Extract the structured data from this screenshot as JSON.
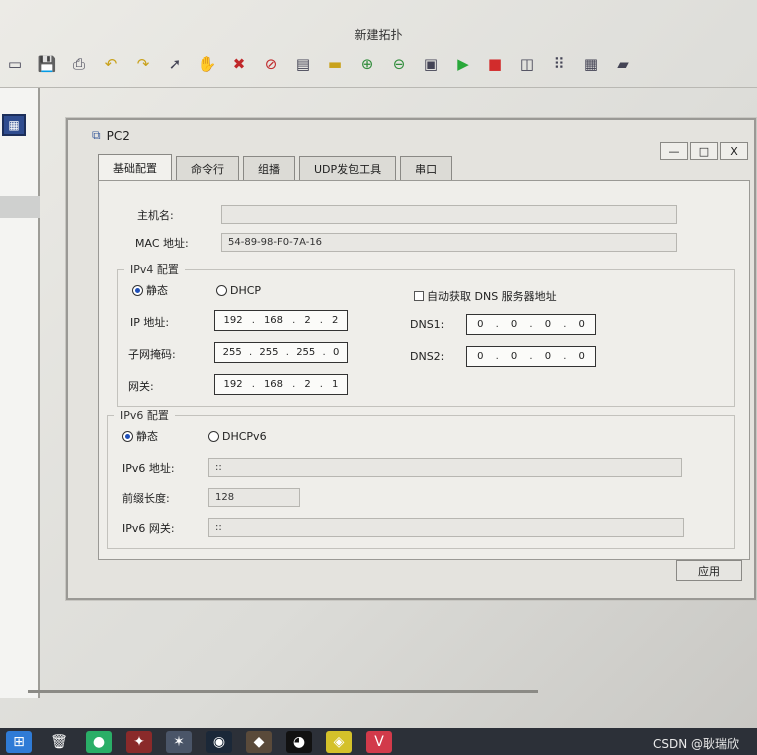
{
  "app": {
    "title": "新建拓扑"
  },
  "toolbar": {
    "icons": [
      "open-icon",
      "save-icon",
      "print-icon",
      "undo-icon",
      "redo-icon",
      "pointer-icon",
      "hand-icon",
      "delete-icon",
      "delete-link-icon",
      "text-icon",
      "rectangle-icon",
      "zoom-in-icon",
      "zoom-out-icon",
      "fit-icon",
      "start-icon",
      "stop-icon",
      "capture-icon",
      "topology-icon",
      "grid-icon",
      "cli-icon"
    ]
  },
  "dialog": {
    "title": "PC2",
    "controls": {
      "minimize": "—",
      "maximize": "□",
      "close": "X"
    },
    "tabs": [
      {
        "label": "基础配置",
        "active": true
      },
      {
        "label": "命令行",
        "active": false
      },
      {
        "label": "组播",
        "active": false
      },
      {
        "label": "UDP发包工具",
        "active": false
      },
      {
        "label": "串口",
        "active": false
      }
    ],
    "basic": {
      "hostname_label": "主机名:",
      "hostname_value": "",
      "mac_label": "MAC 地址:",
      "mac_value": "54-89-98-F0-7A-16"
    },
    "ipv4": {
      "title": "IPv4 配置",
      "static_label": "静态",
      "dhcp_label": "DHCP",
      "mode": "static",
      "auto_dns_label": "自动获取 DNS 服务器地址",
      "auto_dns_checked": false,
      "ip_label": "IP 地址:",
      "ip": [
        "192",
        "168",
        "2",
        "2"
      ],
      "mask_label": "子网掩码:",
      "mask": [
        "255",
        "255",
        "255",
        "0"
      ],
      "gateway_label": "网关:",
      "gateway": [
        "192",
        "168",
        "2",
        "1"
      ],
      "dns1_label": "DNS1:",
      "dns1": [
        "0",
        "0",
        "0",
        "0"
      ],
      "dns2_label": "DNS2:",
      "dns2": [
        "0",
        "0",
        "0",
        "0"
      ],
      "dot": "."
    },
    "ipv6": {
      "title": "IPv6 配置",
      "static_label": "静态",
      "dhcp_label": "DHCPv6",
      "mode": "static",
      "addr_label": "IPv6 地址:",
      "addr_value": "::",
      "prefix_label": "前缀长度:",
      "prefix_value": "128",
      "gw_label": "IPv6 网关:",
      "gw_value": "::"
    },
    "apply_label": "应用"
  },
  "taskbar": {
    "items": [
      "windows-icon",
      "recycle-bin-icon",
      "wechat-icon",
      "game-icon",
      "cs-icon",
      "steam-icon",
      "game2-icon",
      "qq-icon",
      "app-icon",
      "valorant-icon"
    ]
  },
  "watermark": "CSDN @耿瑞欣"
}
